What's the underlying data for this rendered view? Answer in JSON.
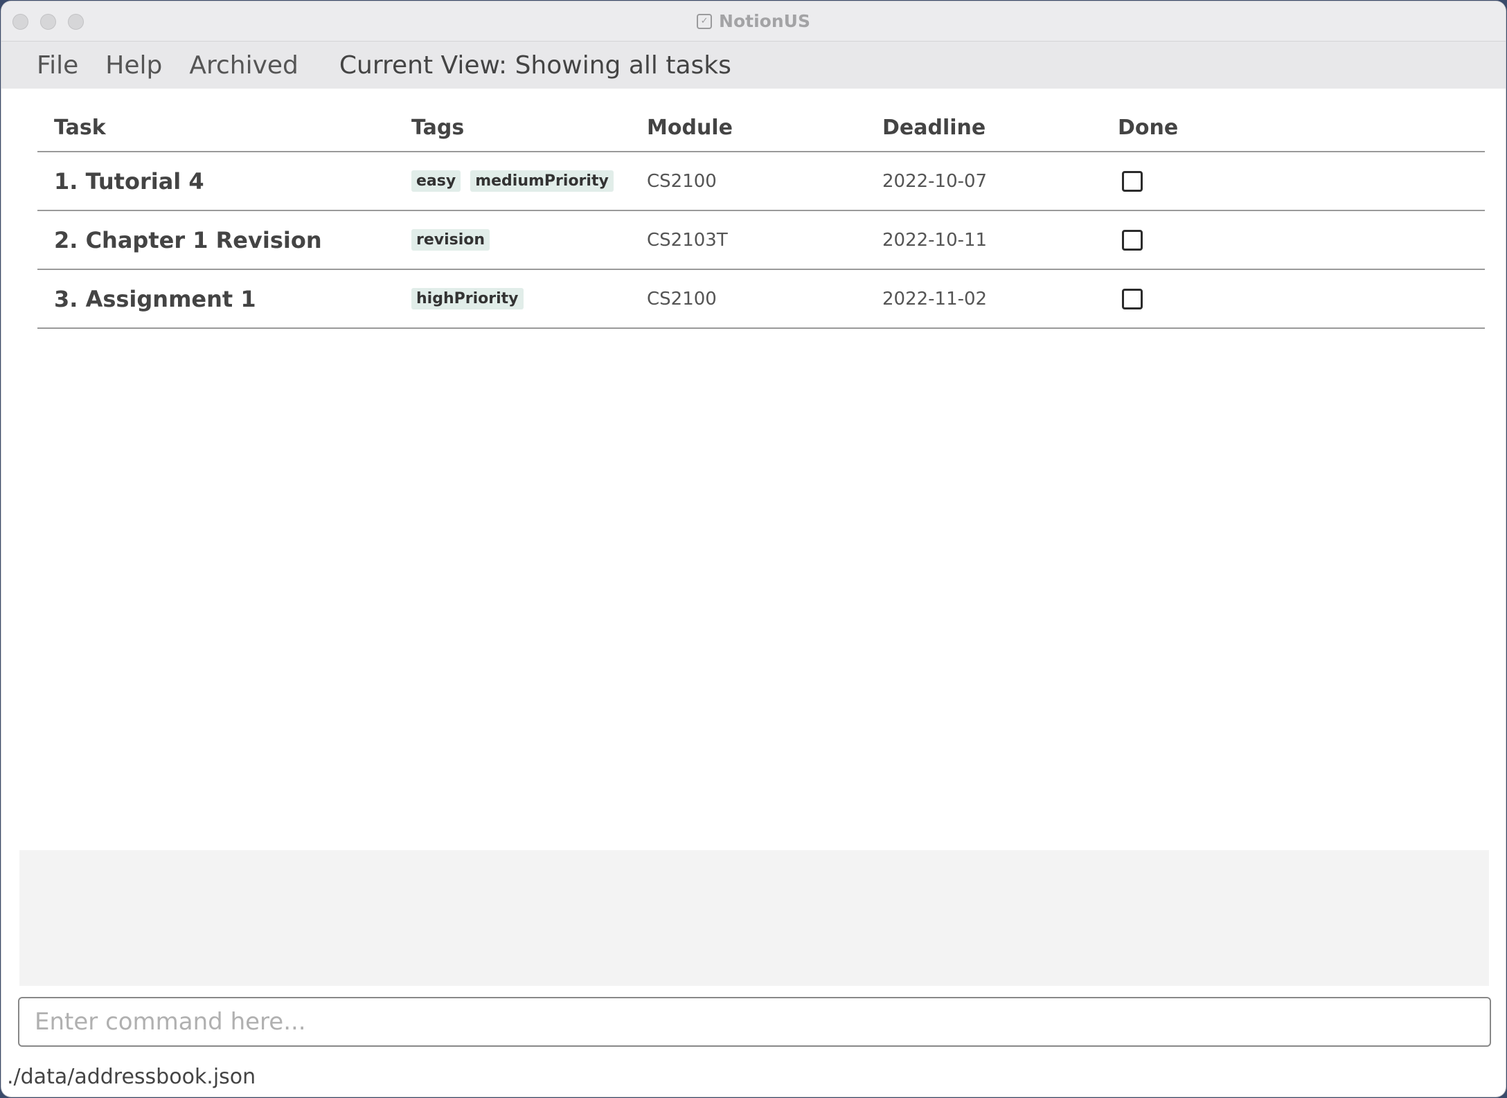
{
  "window": {
    "title": "NotionUS"
  },
  "menu": {
    "items": [
      "File",
      "Help",
      "Archived"
    ],
    "current_view": "Current View: Showing all tasks"
  },
  "table": {
    "headers": {
      "task": "Task",
      "tags": "Tags",
      "module": "Module",
      "deadline": "Deadline",
      "done": "Done"
    },
    "rows": [
      {
        "task": "1. Tutorial 4",
        "tags": [
          "easy",
          "mediumPriority"
        ],
        "module": "CS2100",
        "deadline": "2022-10-07",
        "done": false
      },
      {
        "task": "2. Chapter 1 Revision",
        "tags": [
          "revision"
        ],
        "module": "CS2103T",
        "deadline": "2022-10-11",
        "done": false
      },
      {
        "task": "3. Assignment 1",
        "tags": [
          "highPriority"
        ],
        "module": "CS2100",
        "deadline": "2022-11-02",
        "done": false
      }
    ]
  },
  "command": {
    "placeholder": "Enter command here...",
    "value": ""
  },
  "status": {
    "path": "./data/addressbook.json"
  },
  "colors": {
    "tag_bg": "#e1ede9",
    "menubar_bg": "#e8e8ea",
    "result_bg": "#f3f3f3"
  }
}
